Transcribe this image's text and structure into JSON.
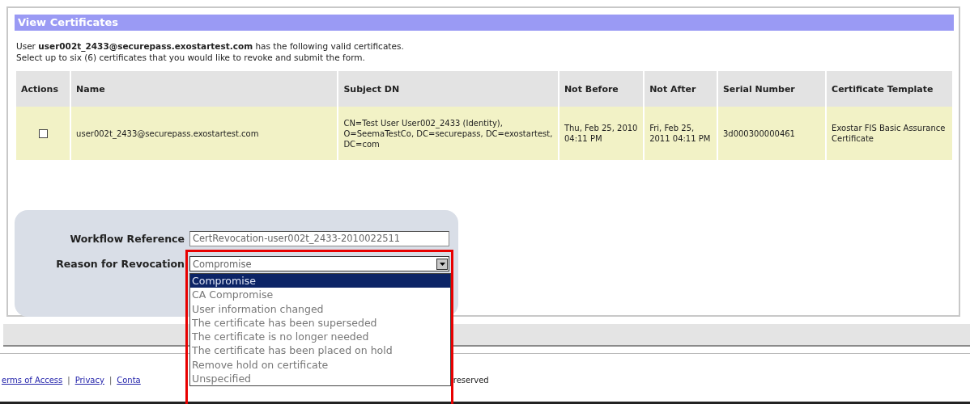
{
  "panel": {
    "title": "View Certificates",
    "intro": "User **user002t_2433@securepass.exostartest.com** has the following valid certificates.",
    "instruction": "Select up to six (6) certificates that you would like to revoke and submit the form."
  },
  "table": {
    "columns": [
      "Actions",
      "Name",
      "Subject DN",
      "Not Before",
      "Not After",
      "Serial Number",
      "Certificate Template"
    ],
    "rows": [
      {
        "cells": [
          {
            "kind": "checkbox",
            "checked": false
          },
          {
            "kind": "text",
            "text": "user002t_2433@securepass.exostartest.com"
          },
          {
            "kind": "text",
            "text": "CN=Test User User002_2433 (Identity), O=SeemaTestCo, DC=securepass, DC=exostartest, DC=com"
          },
          {
            "kind": "text",
            "text": "Thu, Feb 25, 2010 04:11 PM"
          },
          {
            "kind": "text",
            "text": "Fri, Feb 25, 2011 04:11 PM"
          },
          {
            "kind": "text",
            "text": "3d000300000461"
          },
          {
            "kind": "text",
            "text": "Exostar FIS Basic Assurance Certificate"
          }
        ]
      }
    ]
  },
  "form": {
    "workflow_reference": {
      "label": "Workflow Reference",
      "value": "CertRevocation-user002t_2433-2010022511"
    },
    "reason": {
      "label": "Reason for Revocation",
      "value": "Compromise",
      "expanded": true,
      "options": [
        {
          "label": "Compromise",
          "selected": true
        },
        {
          "label": "CA Compromise",
          "selected": false
        },
        {
          "label": "User information changed",
          "selected": false
        },
        {
          "label": "The certificate has been superseded",
          "selected": false
        },
        {
          "label": "The certificate is no longer needed",
          "selected": false
        },
        {
          "label": "The certificate has been placed on hold",
          "selected": false
        },
        {
          "label": "Remove hold on certificate",
          "selected": false
        },
        {
          "label": "Unspecified",
          "selected": false
        }
      ]
    }
  },
  "footer": {
    "items": [
      {
        "kind": "link",
        "text": "erms of Access"
      },
      {
        "kind": "separator",
        "text": "|"
      },
      {
        "kind": "link",
        "text": "Privacy"
      },
      {
        "kind": "separator",
        "text": "|"
      },
      {
        "kind": "link",
        "text": "Conta"
      }
    ],
    "text": "reserved"
  }
}
